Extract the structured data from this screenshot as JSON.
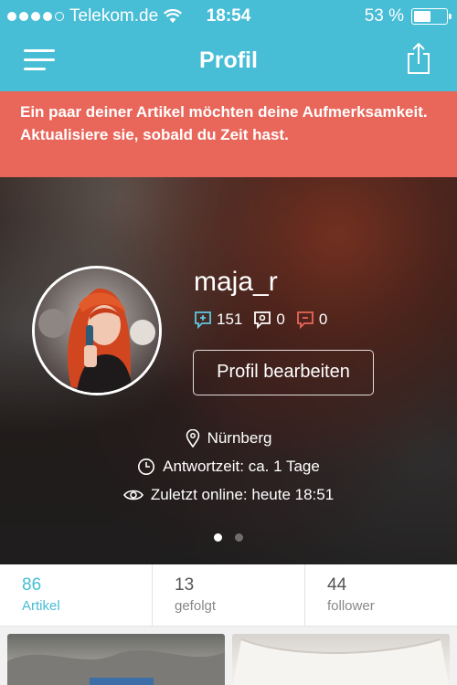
{
  "status_bar": {
    "carrier": "Telekom.de",
    "time": "18:54",
    "battery_percent": "53 %",
    "battery_level": 0.53,
    "signal_bars_filled": 4
  },
  "nav": {
    "title": "Profil",
    "menu_icon": "hamburger-menu-icon",
    "share_icon": "share-icon"
  },
  "alert": {
    "text": "Ein paar deiner Artikel möchten deine Aufmerksamkeit. Aktualisiere sie, sobald du Zeit hast."
  },
  "profile": {
    "username": "maja_r",
    "ratings": {
      "positive": "151",
      "neutral": "0",
      "negative": "0"
    },
    "edit_button": "Profil bearbeiten",
    "location": "Nürnberg",
    "response_time": "Antwortzeit: ca. 1 Tage",
    "last_online": "Zuletzt online: heute 18:51",
    "pager": {
      "pages": 2,
      "active": 1
    }
  },
  "counters": [
    {
      "value": "86",
      "label": "Artikel",
      "active": true
    },
    {
      "value": "13",
      "label": "gefolgt",
      "active": false
    },
    {
      "value": "44",
      "label": "follower",
      "active": false
    }
  ],
  "colors": {
    "brand": "#47bdd6",
    "alert": "#e8665a",
    "rating_positive": "#5fc8e0",
    "rating_negative": "#e8665a"
  }
}
